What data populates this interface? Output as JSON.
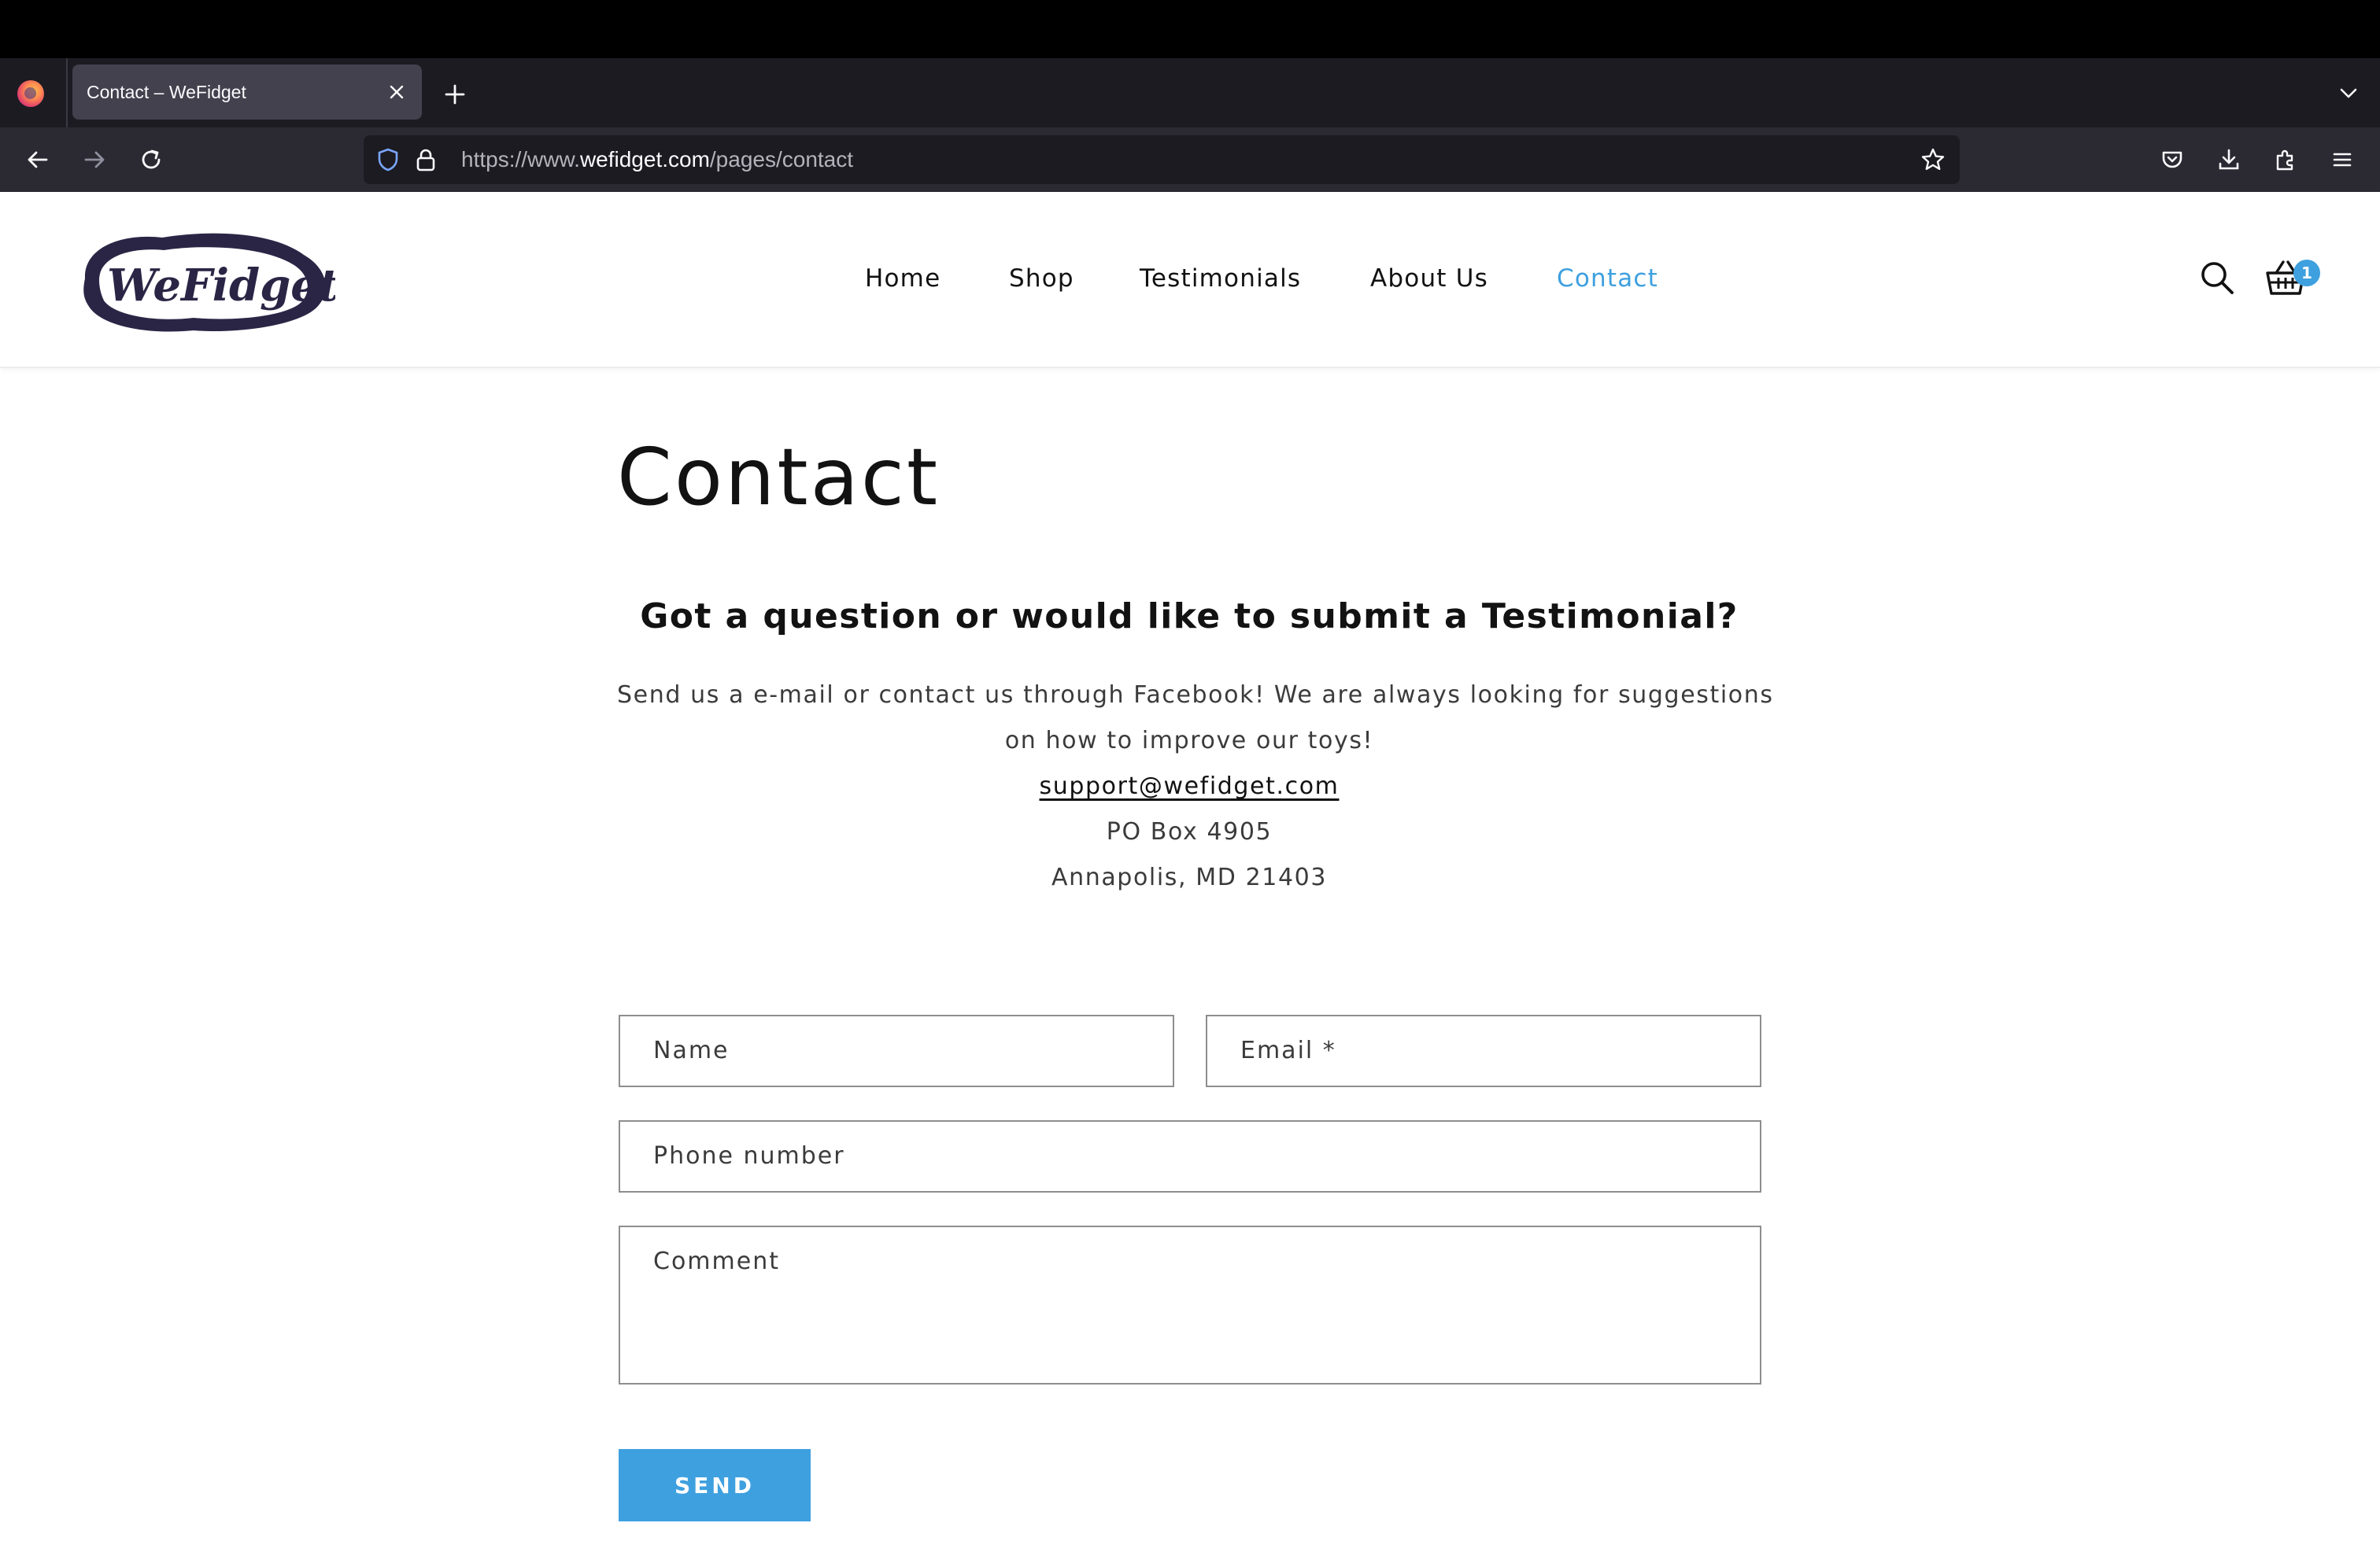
{
  "browser": {
    "tab_title": "Contact – WeFidget",
    "url_prefix": "https://www.",
    "url_domain": "wefidget.com",
    "url_path": "/pages/contact"
  },
  "site": {
    "logo_text": "WeFidget.com",
    "nav": [
      "Home",
      "Shop",
      "Testimonials",
      "About Us",
      "Contact"
    ],
    "active_nav": "Contact",
    "cart_count": "1",
    "accent_color": "#3ea0df"
  },
  "page": {
    "title": "Contact",
    "subheading": "Got a question or would like to submit a Testimonial?",
    "body_line_1": "Send us a e-mail or contact us through Facebook! We are always looking for suggestions",
    "body_line_2": "on how to improve our toys!",
    "email": "support@wefidget.com",
    "address_1": "PO Box 4905",
    "address_2": "Annapolis, MD 21403"
  },
  "form": {
    "name_placeholder": "Name",
    "email_placeholder": "Email *",
    "phone_placeholder": "Phone number",
    "comment_placeholder": "Comment",
    "send_label": "SEND"
  }
}
